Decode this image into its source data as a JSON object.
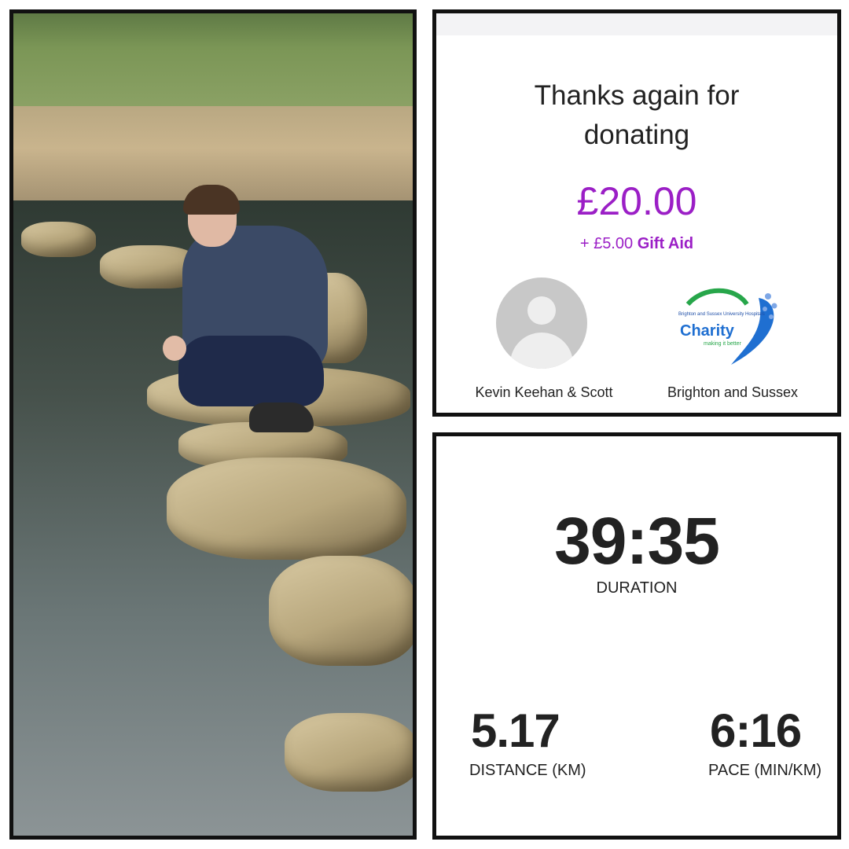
{
  "donation": {
    "title_line1": "Thanks again for",
    "title_line2": "donating",
    "amount": "£20.00",
    "gift_aid_amount": "+ £5.00",
    "gift_aid_label": "Gift Aid",
    "donor_name": "Kevin Keehan & Scott",
    "charity_name": "Brighton and Sussex",
    "charity_logo_text": "Charity",
    "charity_logo_small": "Brighton and Sussex University Hospitals",
    "charity_logo_tag": "making it better",
    "colors": {
      "accent": "#9b1fc6",
      "logo_green": "#27a64a",
      "logo_blue": "#1f6fd1"
    }
  },
  "run": {
    "duration": "39:35",
    "duration_label": "DURATION",
    "distance": "5.17",
    "distance_label": "DISTANCE (KM)",
    "pace": "6:16",
    "pace_label": "PACE (MIN/KM)"
  }
}
